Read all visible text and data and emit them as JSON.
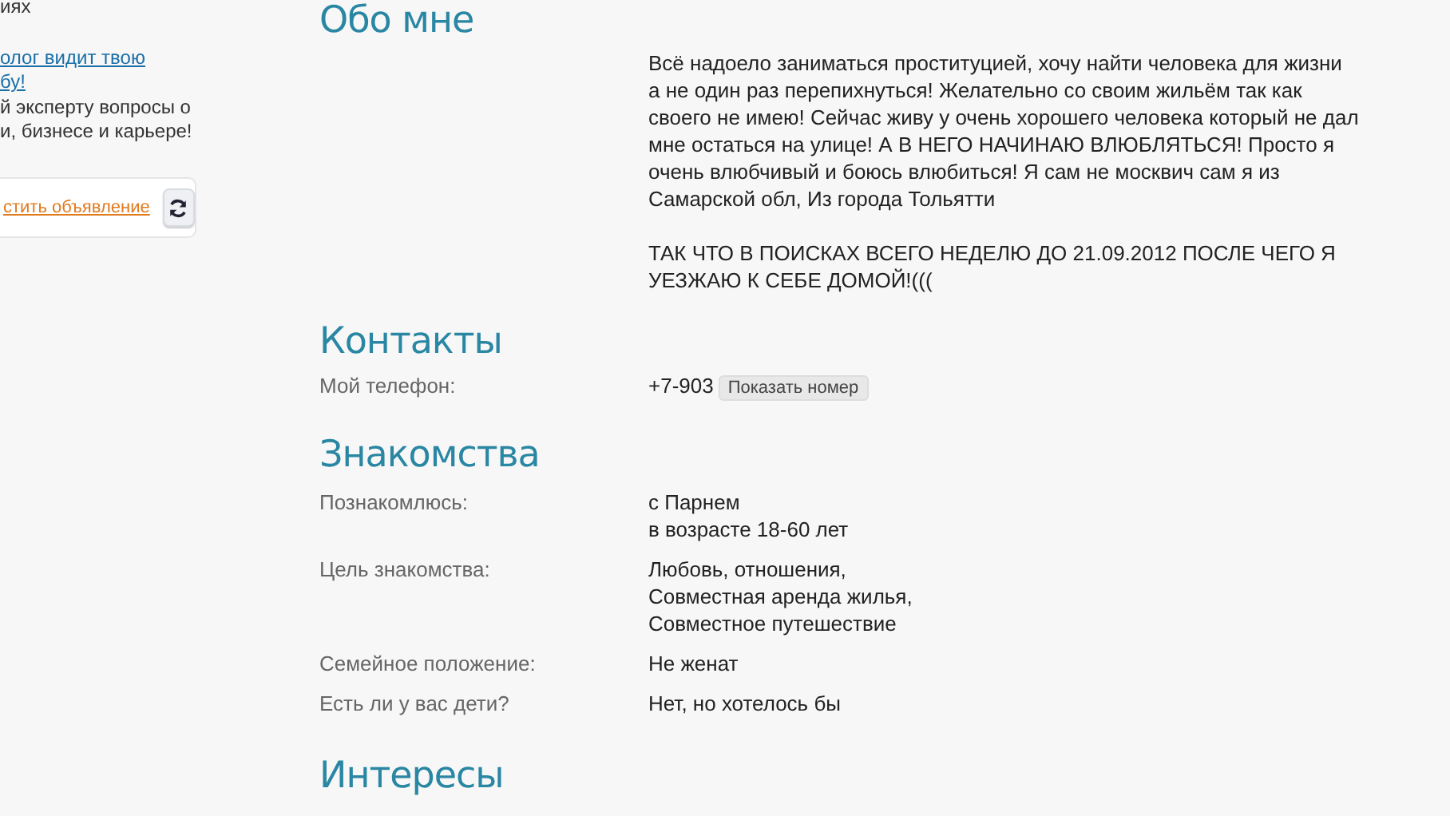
{
  "sidebar": {
    "fragment": "иях",
    "link_lines": [
      "олог видит твою",
      "бу!"
    ],
    "promo_lines": [
      "й эксперту вопросы о",
      "и, бизнесе и карьере!"
    ],
    "ad_link": "стить объявление"
  },
  "about": {
    "heading": "Обо мне",
    "paragraphs": [
      "Всё надоело заниматься проституцией, хочу найти человека для жизни а не один раз перепихнуться! Желательно со своим жильём так как своего не имею! Сейчас живу у очень хорошего человека который не дал мне остаться на улице! А В НЕГО НАЧИНАЮ ВЛЮБЛЯТЬСЯ! Просто я очень влюбчивый и боюсь влюбиться! Я сам не москвич сам я из Самарской обл, Из города Тольятти",
      "ТАК ЧТО В ПОИСКАХ ВСЕГО НЕДЕЛЮ ДО 21.09.2012 ПОСЛЕ ЧЕГО Я УЕЗЖАЮ К СЕБЕ ДОМОЙ!((("
    ]
  },
  "contacts": {
    "heading": "Контакты",
    "label": "Мой телефон:",
    "phone": "+7-903",
    "show_button": "Показать номер"
  },
  "dating": {
    "heading": "Знакомства",
    "rows": [
      {
        "label": "Познакомлюсь:",
        "lines": [
          "с Парнем",
          "в возрасте 18-60 лет"
        ]
      },
      {
        "label": "Цель знакомства:",
        "lines": [
          "Любовь, отношения,",
          "Совместная аренда жилья,",
          "Совместное путешествие"
        ]
      },
      {
        "label": "Семейное положение:",
        "lines": [
          "Не женат"
        ]
      },
      {
        "label": "Есть ли у вас дети?",
        "lines": [
          "Нет, но хотелось бы"
        ]
      }
    ]
  },
  "interests": {
    "heading": "Интересы"
  }
}
